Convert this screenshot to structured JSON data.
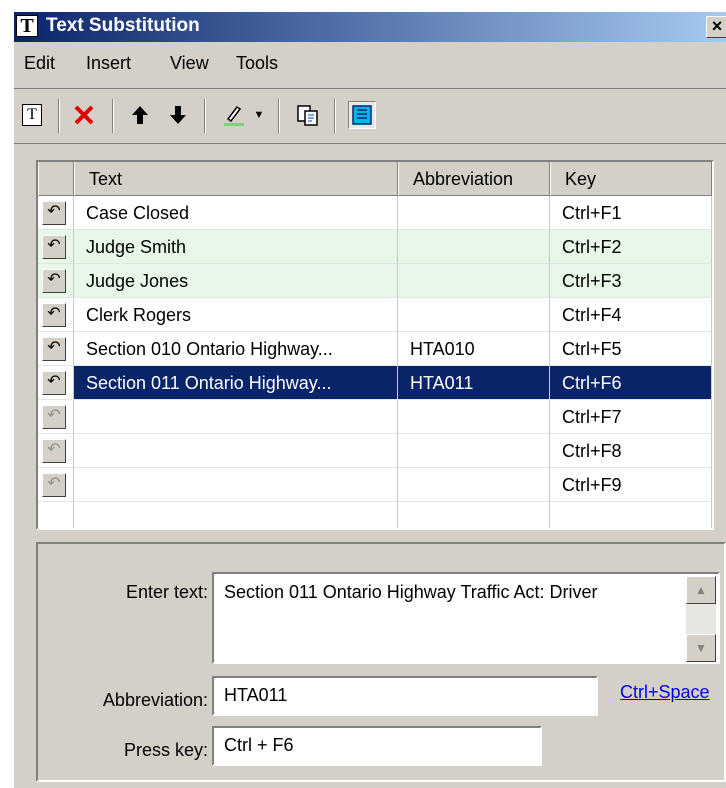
{
  "window": {
    "title": "Text Substitution",
    "close": "×",
    "title_icon": "T"
  },
  "menu": {
    "items": [
      "Edit",
      "Insert",
      "View",
      "Tools"
    ]
  },
  "grid": {
    "columns": [
      "Text",
      "Abbreviation",
      "Key"
    ],
    "rows": [
      {
        "text": "Case Closed",
        "abbr": "",
        "key": "Ctrl+F1",
        "style": "normal"
      },
      {
        "text": "Judge Smith",
        "abbr": "",
        "key": "Ctrl+F2",
        "style": "green"
      },
      {
        "text": "Judge Jones",
        "abbr": "",
        "key": "Ctrl+F3",
        "style": "green"
      },
      {
        "text": "Clerk Rogers",
        "abbr": "",
        "key": "Ctrl+F4",
        "style": "normal"
      },
      {
        "text": "Section 010 Ontario Highway...",
        "abbr": "HTA010",
        "key": "Ctrl+F5",
        "style": "normal"
      },
      {
        "text": "Section 011 Ontario Highway...",
        "abbr": "HTA011",
        "key": "Ctrl+F6",
        "style": "selected"
      },
      {
        "text": "",
        "abbr": "",
        "key": "Ctrl+F7",
        "style": "empty"
      },
      {
        "text": "",
        "abbr": "",
        "key": "Ctrl+F8",
        "style": "empty"
      },
      {
        "text": "",
        "abbr": "",
        "key": "Ctrl+F9",
        "style": "empty"
      }
    ]
  },
  "editor": {
    "enter_text_label": "Enter text:",
    "enter_text_value": "Section 011 Ontario Highway Traffic Act: Driver",
    "abbreviation_label": "Abbreviation:",
    "abbreviation_value": "HTA011",
    "shortcut_link": "Ctrl+Space",
    "press_key_label": "Press key:",
    "press_key_value": "Ctrl + F6"
  }
}
